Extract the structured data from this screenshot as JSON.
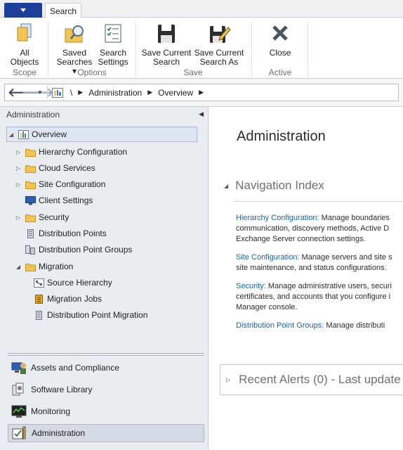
{
  "ribbon": {
    "tab_active": "Search",
    "buttons": {
      "all_objects": {
        "line1": "All",
        "line2": "Objects"
      },
      "saved_searches": {
        "line1": "Saved",
        "line2": "Searches ▾"
      },
      "search_settings": {
        "line1": "Search",
        "line2": "Settings"
      },
      "save_current_search": {
        "line1": "Save Current",
        "line2": "Search"
      },
      "save_current_search_as": {
        "line1": "Save Current",
        "line2": "Search As"
      },
      "close": {
        "line1": "Close"
      }
    },
    "groups": {
      "scope": "Scope",
      "options": "Options",
      "save": "Save",
      "active_search": "Active Search"
    }
  },
  "address_bar": {
    "back_icon": "back-arrow-icon",
    "forward_icon": "forward-arrow-icon",
    "root": "\\",
    "crumbs": [
      "Administration",
      "Overview"
    ]
  },
  "left_pane": {
    "header": "Administration",
    "tree": [
      {
        "label": "Overview",
        "icon": "overview-icon",
        "expander": "◢",
        "selected": true
      },
      {
        "label": "Hierarchy Configuration",
        "icon": "folder-icon",
        "expander": "▷"
      },
      {
        "label": "Cloud Services",
        "icon": "folder-icon",
        "expander": "▷"
      },
      {
        "label": "Site Configuration",
        "icon": "folder-icon",
        "expander": "▷"
      },
      {
        "label": "Client Settings",
        "icon": "client-settings-icon",
        "expander": ""
      },
      {
        "label": "Security",
        "icon": "folder-icon",
        "expander": "▷"
      },
      {
        "label": "Distribution Points",
        "icon": "server-icon",
        "expander": ""
      },
      {
        "label": "Distribution Point Groups",
        "icon": "server-group-icon",
        "expander": ""
      },
      {
        "label": "Migration",
        "icon": "folder-icon",
        "expander": "◢"
      },
      {
        "label": "Source Hierarchy",
        "icon": "hierarchy-icon",
        "expander": ""
      },
      {
        "label": "Migration Jobs",
        "icon": "jobs-icon",
        "expander": ""
      },
      {
        "label": "Distribution Point Migration",
        "icon": "server-icon",
        "expander": ""
      }
    ],
    "workspaces": [
      {
        "label": "Assets and Compliance",
        "icon": "assets-icon"
      },
      {
        "label": "Software Library",
        "icon": "software-library-icon"
      },
      {
        "label": "Monitoring",
        "icon": "monitoring-icon"
      },
      {
        "label": "Administration",
        "icon": "administration-icon",
        "selected": true
      }
    ]
  },
  "main": {
    "title": "Administration",
    "nav_index_heading": "Navigation Index",
    "entries": [
      {
        "link": "Hierarchy Configuration:",
        "line1": " Manage boundaries",
        "line2": "communication, discovery methods, Active D",
        "line3": "Exchange Server connection settings."
      },
      {
        "link": "Site Configuration:",
        "line1": " Manage servers and site s",
        "line2": "site maintenance, and status configurations."
      },
      {
        "link": "Security:",
        "line1": " Manage administrative users, securi",
        "line2": "certificates, and accounts that you configure i",
        "line3": "Manager console."
      },
      {
        "link": "Distribution Point Groups:",
        "line1": " Manage distributi"
      }
    ],
    "recent_alerts": "Recent Alerts (0) - Last update"
  }
}
